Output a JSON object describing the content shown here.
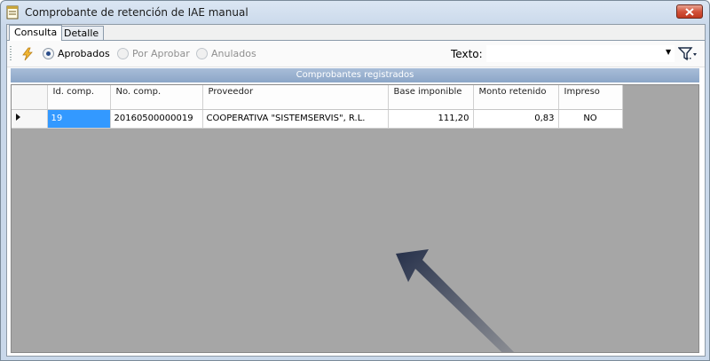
{
  "window": {
    "title": "Comprobante de retención de IAE manual"
  },
  "tabs": [
    {
      "label": "Consulta"
    },
    {
      "label": "Detalle"
    }
  ],
  "toolbar": {
    "filters": [
      {
        "label": "Aprobados",
        "selected": true
      },
      {
        "label": "Por Aprobar",
        "selected": false
      },
      {
        "label": "Anulados",
        "selected": false
      }
    ],
    "texto_label": "Texto:",
    "texto_value": ""
  },
  "grid": {
    "caption": "Comprobantes registrados",
    "columns": [
      {
        "label": "Id. comp."
      },
      {
        "label": "No. comp."
      },
      {
        "label": "Proveedor"
      },
      {
        "label": "Base imponible"
      },
      {
        "label": "Monto retenido"
      },
      {
        "label": "Impreso"
      }
    ],
    "rows": [
      {
        "id": "19",
        "no_comp": "20160500000019",
        "proveedor": "COOPERATIVA \"SISTEMSERVIS\", R.L.",
        "base": "111,20",
        "monto": "0,83",
        "impreso": "NO"
      }
    ]
  },
  "colors": {
    "selection": "#3399ff",
    "band": "#8ca6c8",
    "grid_empty": "#a6a6a6"
  }
}
